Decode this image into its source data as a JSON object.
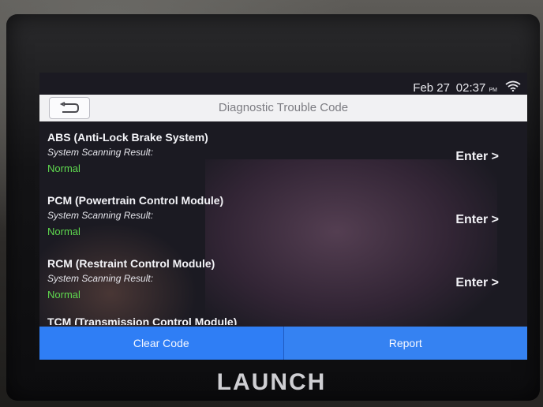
{
  "status": {
    "date": "Feb 27",
    "time": "02:37",
    "ampm": "PM"
  },
  "header": {
    "title": "Diagnostic Trouble Code"
  },
  "systems": [
    {
      "name": "ABS (Anti-Lock Brake System)",
      "label": "System Scanning Result:",
      "status": "Normal",
      "action": "Enter >"
    },
    {
      "name": "PCM (Powertrain Control Module)",
      "label": "System Scanning Result:",
      "status": "Normal",
      "action": "Enter >"
    },
    {
      "name": "RCM (Restraint Control Module)",
      "label": "System Scanning Result:",
      "status": "Normal",
      "action": "Enter >"
    },
    {
      "name": "TCM (Transmission Control Module)"
    }
  ],
  "footer": {
    "clear_label": "Clear Code",
    "report_label": "Report"
  },
  "brand": "LAUNCH",
  "colors": {
    "accent": "#2f7ef5",
    "status_normal": "#5fd94f",
    "title_bar": "#f1f1f3"
  }
}
